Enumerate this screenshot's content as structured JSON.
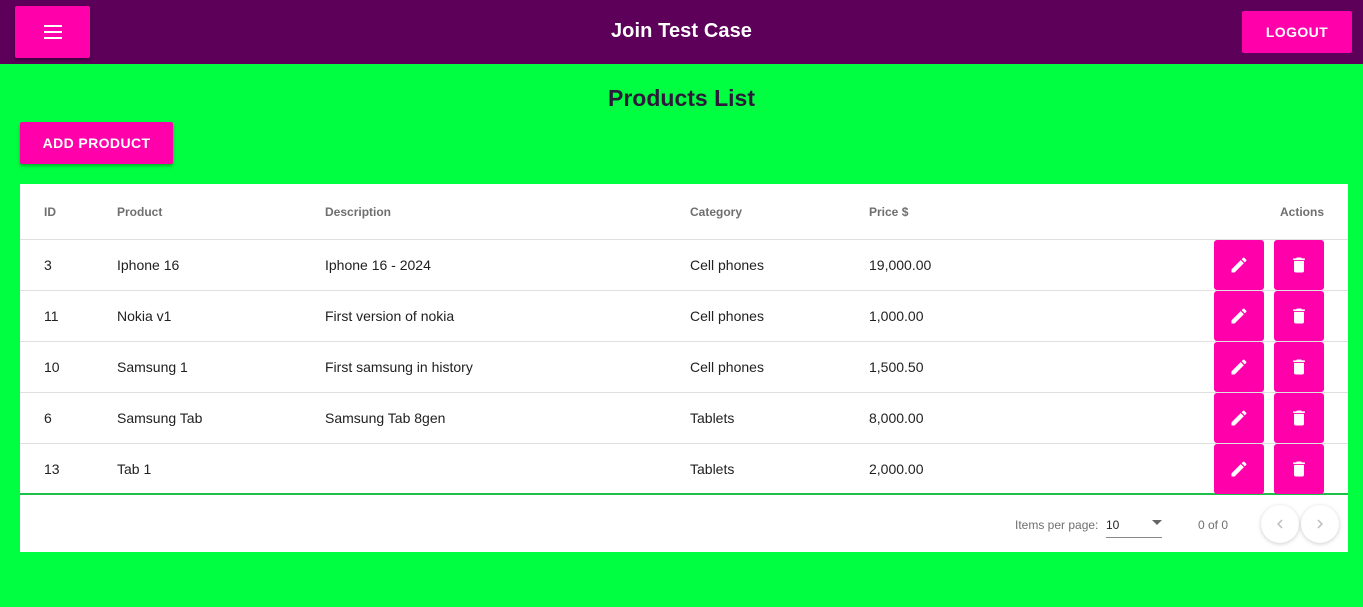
{
  "header": {
    "title": "Join Test Case",
    "logout_label": "LOGOUT",
    "menu_icon": "menu-icon"
  },
  "page": {
    "title": "Products List",
    "add_label": "ADD PRODUCT"
  },
  "table": {
    "columns": {
      "id": "ID",
      "product": "Product",
      "description": "Description",
      "category": "Category",
      "price": "Price $",
      "actions": "Actions"
    },
    "rows": [
      {
        "id": "3",
        "product": "Iphone 16",
        "description": "Iphone 16 - 2024",
        "category": "Cell phones",
        "price": "19,000.00"
      },
      {
        "id": "11",
        "product": "Nokia v1",
        "description": "First version of nokia",
        "category": "Cell phones",
        "price": "1,000.00"
      },
      {
        "id": "10",
        "product": "Samsung 1",
        "description": "First samsung in history",
        "category": "Cell phones",
        "price": "1,500.50"
      },
      {
        "id": "6",
        "product": "Samsung Tab",
        "description": "Samsung Tab 8gen",
        "category": "Tablets",
        "price": "8,000.00"
      },
      {
        "id": "13",
        "product": "Tab 1",
        "description": "",
        "category": "Tablets",
        "price": "2,000.00"
      }
    ]
  },
  "paginator": {
    "items_per_page_label": "Items per page:",
    "items_per_page_value": "10",
    "range_label": "0 of 0"
  },
  "colors": {
    "background": "#00ff40",
    "header": "#5c0059",
    "accent": "#ff00aa"
  }
}
